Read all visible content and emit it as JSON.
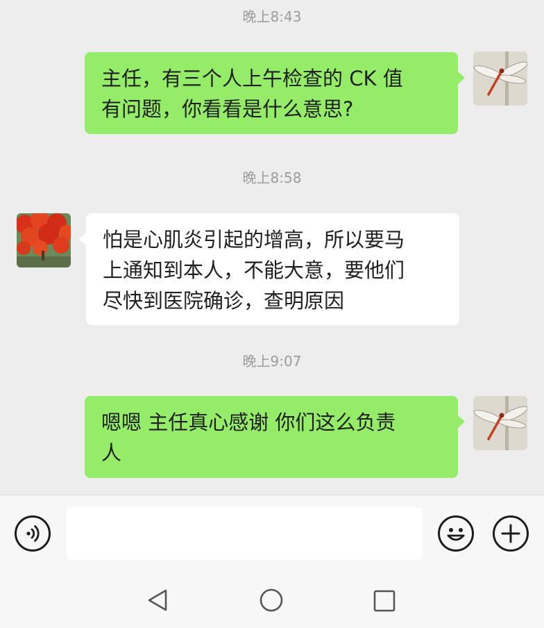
{
  "messages": [
    {
      "type": "time",
      "text": "晚上8:43"
    },
    {
      "type": "out",
      "sender": "me",
      "avatar": "dragonfly-avatar",
      "text": "主任，有三个人上午检查的 CK 值\n有问题，你看看是什么意思?"
    },
    {
      "type": "time",
      "text": "晚上8:58"
    },
    {
      "type": "in",
      "sender": "主任",
      "avatar": "red-flowers-avatar",
      "text": "怕是心肌炎引起的增高，所以要马\n上通知到本人，不能大意，要他们\n尽快到医院确诊，查明原因"
    },
    {
      "type": "time",
      "text": "晚上9:07"
    },
    {
      "type": "out",
      "sender": "me",
      "avatar": "dragonfly-avatar",
      "text": "嗯嗯 主任真心感谢 你们这么负责\n人"
    }
  ],
  "input_bar": {
    "voice_icon": "voice-icon",
    "message_value": "",
    "emoji_icon": "emoji-icon",
    "add_icon": "plus-icon"
  },
  "system_nav": {
    "back_icon": "back-triangle-icon",
    "home_icon": "home-circle-icon",
    "recents_icon": "recents-square-icon"
  },
  "colors": {
    "background": "#ededed",
    "outgoing_bubble": "#95ec69",
    "incoming_bubble": "#ffffff",
    "timestamp": "#9b9b9b"
  }
}
